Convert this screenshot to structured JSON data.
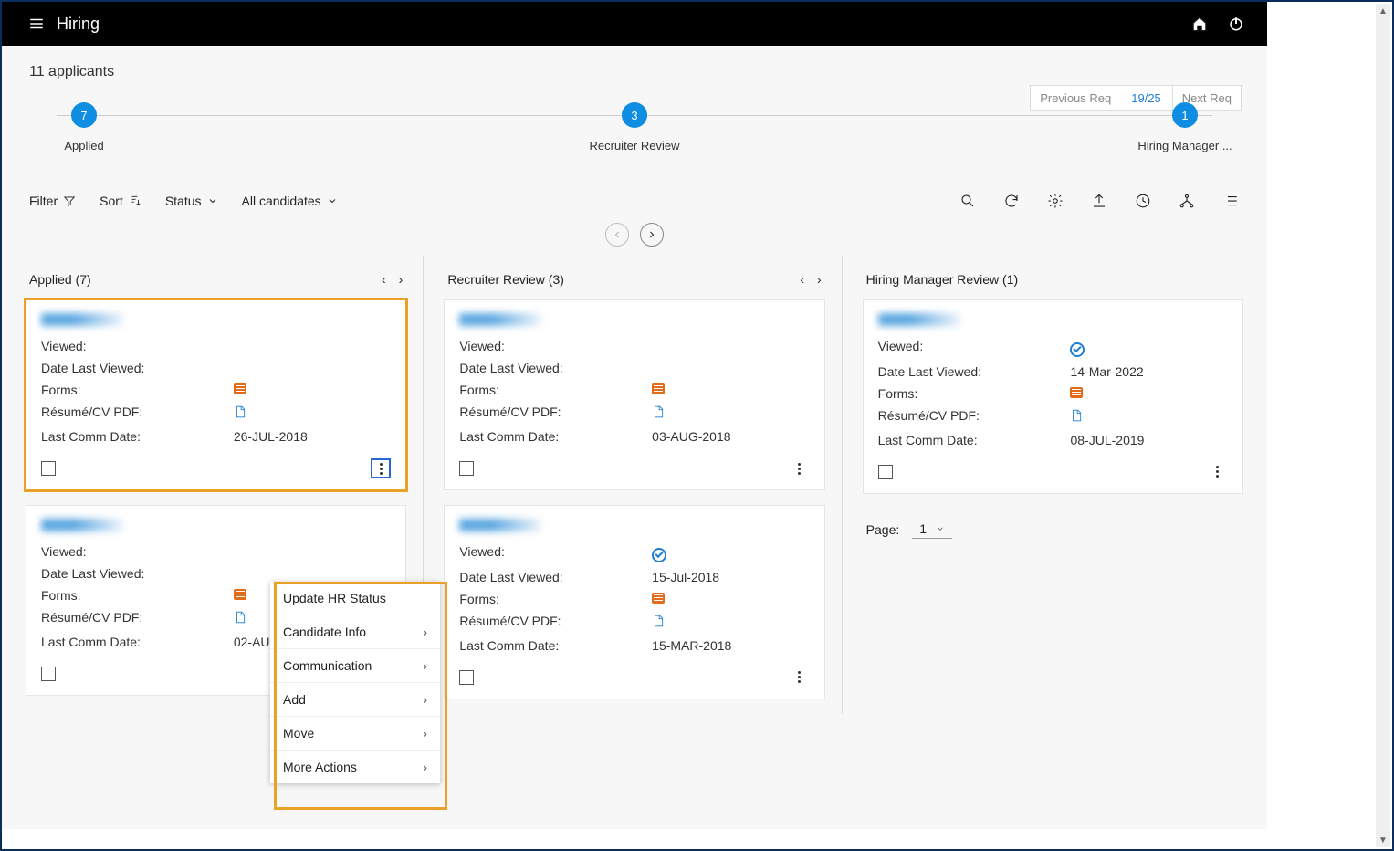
{
  "topbar": {
    "title": "Hiring"
  },
  "reqnav": {
    "prev": "Previous Req",
    "counter": "19/25",
    "next": "Next Req"
  },
  "applicant_count": "11 applicants",
  "stages": [
    {
      "count": "7",
      "label": "Applied"
    },
    {
      "count": "3",
      "label": "Recruiter Review"
    },
    {
      "count": "1",
      "label": "Hiring Manager ..."
    }
  ],
  "toolbar": {
    "filter": "Filter",
    "sort": "Sort",
    "status": "Status",
    "candidates": "All candidates"
  },
  "columns": [
    {
      "title": "Applied (7)",
      "has_arrows": true,
      "cards": [
        {
          "highlight": true,
          "viewed": "",
          "date_last_viewed": "",
          "has_forms": true,
          "has_pdf": true,
          "last_comm": "26-JUL-2018",
          "kebab_active": true
        },
        {
          "highlight": false,
          "viewed": "",
          "date_last_viewed": "",
          "has_forms": true,
          "has_pdf": true,
          "last_comm": "02-AU",
          "kebab_active": false
        }
      ]
    },
    {
      "title": "Recruiter Review (3)",
      "has_arrows": true,
      "cards": [
        {
          "highlight": false,
          "viewed": "",
          "date_last_viewed": "",
          "has_forms": true,
          "has_pdf": true,
          "last_comm": "03-AUG-2018",
          "kebab_active": false
        },
        {
          "highlight": false,
          "viewed_check": true,
          "date_last_viewed": "15-Jul-2018",
          "has_forms": true,
          "has_pdf": true,
          "last_comm": "15-MAR-2018",
          "kebab_active": false
        }
      ]
    },
    {
      "title": "Hiring Manager Review (1)",
      "has_arrows": false,
      "cards": [
        {
          "highlight": false,
          "viewed_check": true,
          "date_last_viewed": "14-Mar-2022",
          "has_forms": true,
          "has_pdf": true,
          "last_comm": "08-JUL-2019",
          "kebab_active": false
        }
      ],
      "page_label": "Page:",
      "page_value": "1"
    }
  ],
  "labels": {
    "viewed": "Viewed:",
    "date_last_viewed": "Date Last Viewed:",
    "forms": "Forms:",
    "resume": "Résumé/CV PDF:",
    "last_comm": "Last Comm Date:"
  },
  "menu": {
    "items": [
      {
        "label": "Update HR Status",
        "chev": false
      },
      {
        "label": "Candidate Info",
        "chev": true
      },
      {
        "label": "Communication",
        "chev": true
      },
      {
        "label": "Add",
        "chev": true
      },
      {
        "label": "Move",
        "chev": true
      },
      {
        "label": "More Actions",
        "chev": true
      }
    ]
  }
}
